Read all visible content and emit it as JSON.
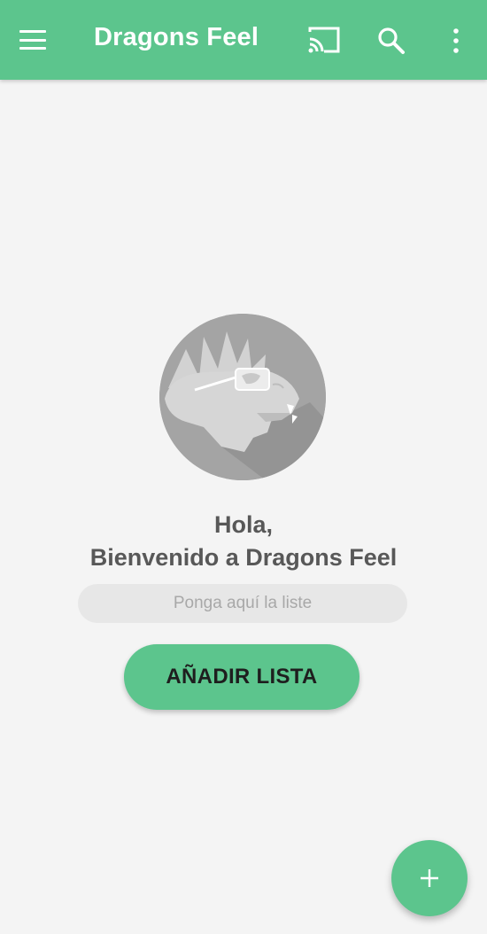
{
  "app_bar": {
    "title": "Dragons Feel",
    "background_color": "#5cc58d",
    "menu_icon": "hamburger-menu-icon",
    "actions": [
      {
        "icon": "cast-icon"
      },
      {
        "icon": "search-icon"
      },
      {
        "icon": "more-vert-icon"
      }
    ]
  },
  "main": {
    "avatar_icon": "dragon-with-glasses-logo",
    "greeting_line1": "Hola,",
    "greeting_line2": "Bienvenido a Dragons Feel",
    "list_input": {
      "value": "",
      "placeholder": "Ponga aquí la liste"
    },
    "add_list_button": "AÑADIR LISTA"
  },
  "fab": {
    "icon": "plus-icon",
    "color": "#5cc58d"
  }
}
